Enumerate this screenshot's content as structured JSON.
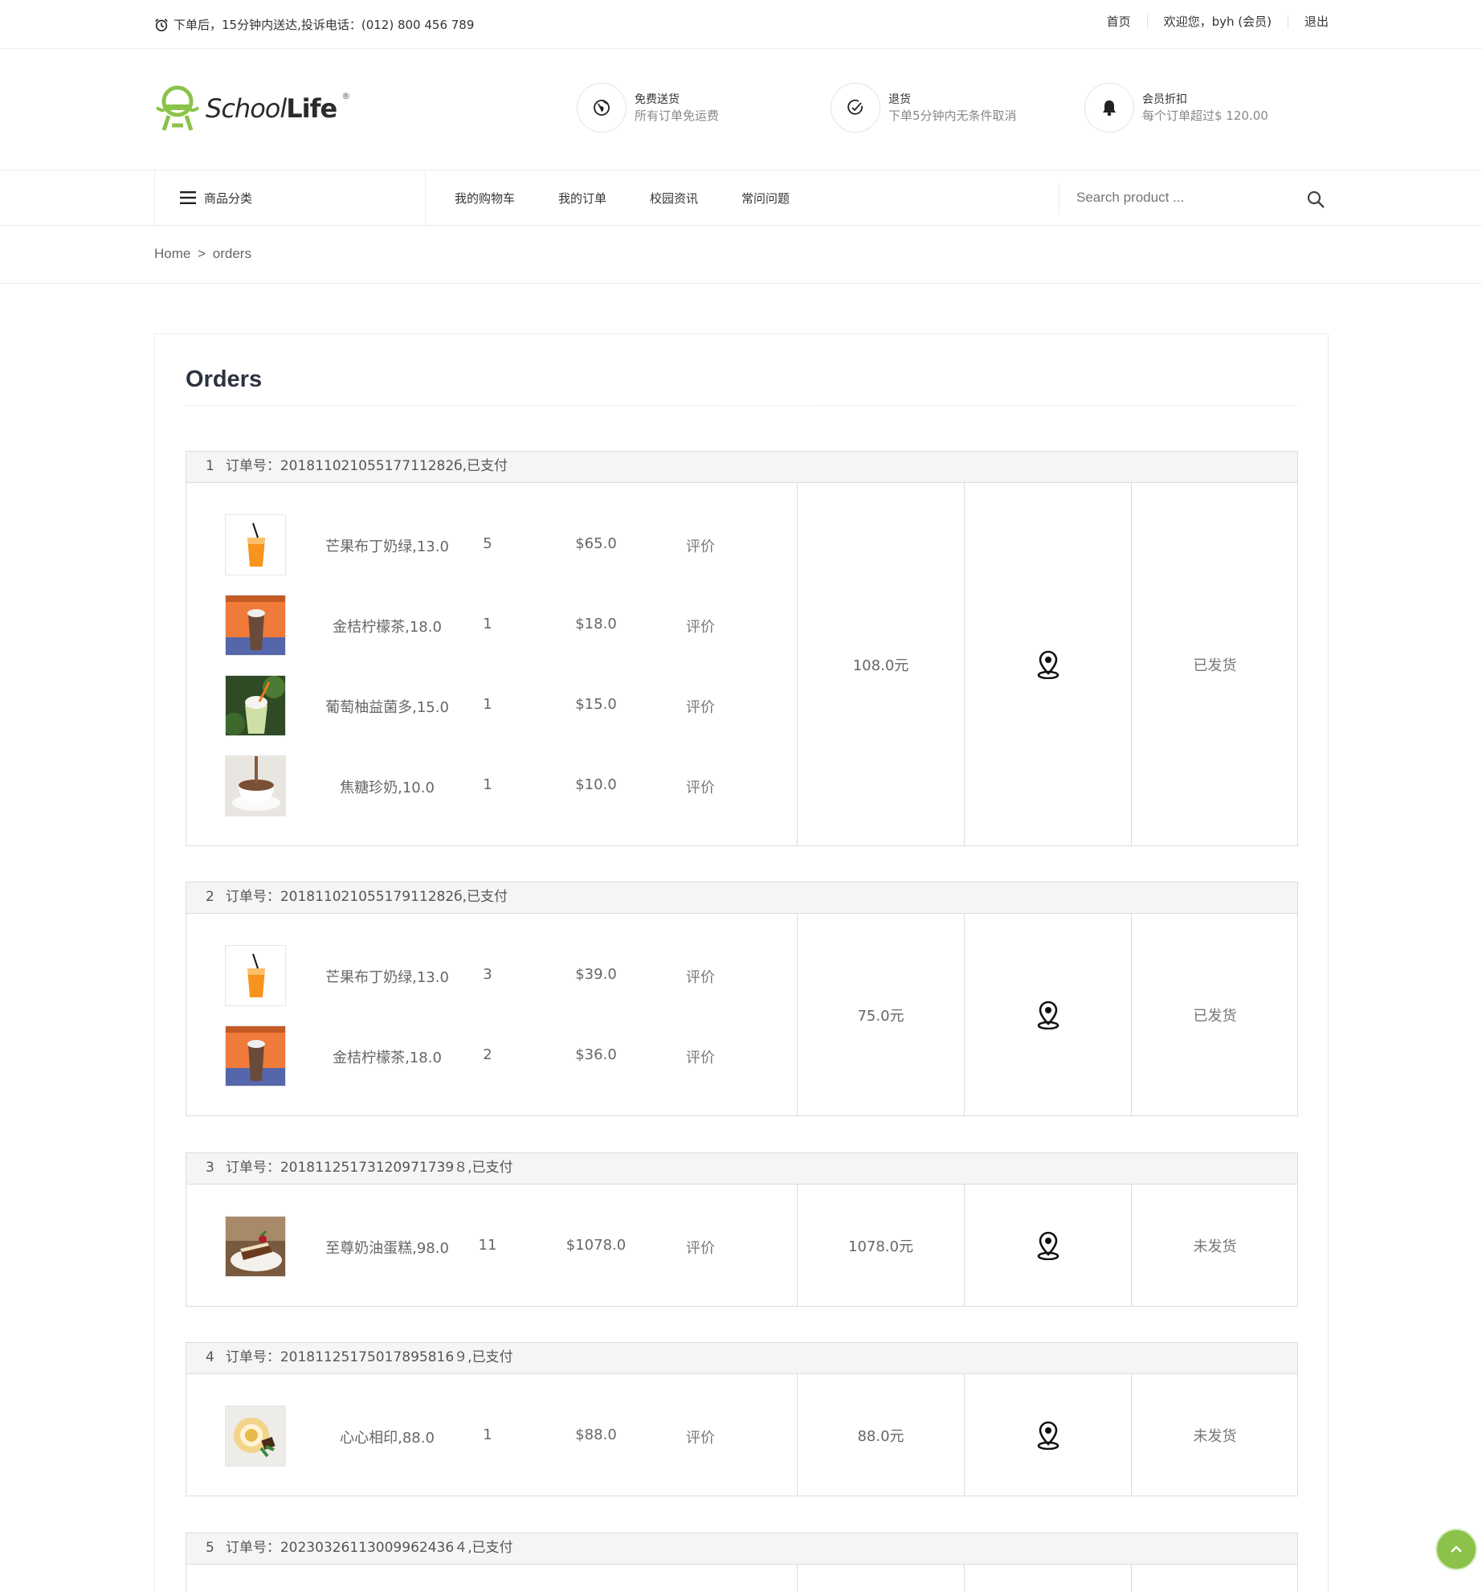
{
  "topbar": {
    "notice": "下单后，15分钟内送达,投诉电话：(012) 800 456 789",
    "links": [
      "首页",
      "欢迎您，byh (会员)",
      "退出"
    ]
  },
  "header": {
    "logo_school": "School",
    "logo_life": "Life",
    "logo_reg": "®",
    "features": [
      {
        "title": "免费送货",
        "desc": "所有订单免运费",
        "icon": "globe-icon"
      },
      {
        "title": "退货",
        "desc": "下单5分钟内无条件取消",
        "icon": "check-circle-icon"
      },
      {
        "title": "会员折扣",
        "desc": "每个订单超过$ 120.00",
        "icon": "bell-icon"
      }
    ]
  },
  "nav": {
    "category": "商品分类",
    "menu": [
      "我的购物车",
      "我的订单",
      "校园资讯",
      "常问问题"
    ],
    "search_placeholder": "Search product ..."
  },
  "breadcrumb": {
    "home": "Home",
    "sep": ">",
    "current": "orders"
  },
  "page_title": "Orders",
  "orders": [
    {
      "index": "1",
      "label": "订单号：20181102105517711282б,已支付",
      "items": [
        {
          "name": "芒果布丁奶绿,13.0",
          "qty": "5",
          "price": "$65.0",
          "review": "评价",
          "img": "mango-drink"
        },
        {
          "name": "金桔柠檬茶,18.0",
          "qty": "1",
          "price": "$18.0",
          "review": "评价",
          "img": "lemon-tea"
        },
        {
          "name": "葡萄柚益菌多,15.0",
          "qty": "1",
          "price": "$15.0",
          "review": "评价",
          "img": "grapefruit-drink"
        },
        {
          "name": "焦糖珍奶,10.0",
          "qty": "1",
          "price": "$10.0",
          "review": "评价",
          "img": "caramel-milk-tea"
        }
      ],
      "total": "108.0元",
      "status": "已发货"
    },
    {
      "index": "2",
      "label": "订单号：20181102105517911282б,已支付",
      "items": [
        {
          "name": "芒果布丁奶绿,13.0",
          "qty": "3",
          "price": "$39.0",
          "review": "评价",
          "img": "mango-drink"
        },
        {
          "name": "金桔柠檬茶,18.0",
          "qty": "2",
          "price": "$36.0",
          "review": "评价",
          "img": "lemon-tea"
        }
      ],
      "total": "75.0元",
      "status": "已发货"
    },
    {
      "index": "3",
      "label": "订单号：20181125173120971739８,已支付",
      "items": [
        {
          "name": "至尊奶油蛋糕,98.0",
          "qty": "11",
          "price": "$1078.0",
          "review": "评价",
          "img": "cream-cake"
        }
      ],
      "total": "1078.0元",
      "status": "未发货"
    },
    {
      "index": "4",
      "label": "订单号：20181125175017895816９,已支付",
      "items": [
        {
          "name": "心心相印,88.0",
          "qty": "1",
          "price": "$88.0",
          "review": "评价",
          "img": "heart-dessert"
        }
      ],
      "total": "88.0元",
      "status": "未发货"
    },
    {
      "index": "5",
      "label": "订单号：20230326113009962436４,已支付",
      "items": [],
      "total": "",
      "status": ""
    }
  ],
  "colors": {
    "brand_green": "#8bc34a",
    "border": "#dcdcdc"
  }
}
